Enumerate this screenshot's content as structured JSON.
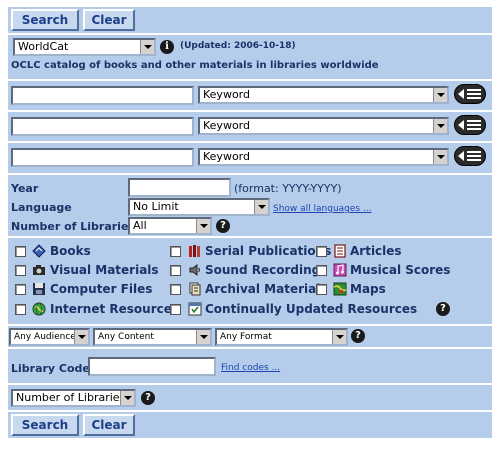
{
  "toolbar_top": {
    "search_label": "Search",
    "clear_label": "Clear"
  },
  "database": {
    "selected": "WorldCat",
    "updated": "(Updated: 2006-10-18)",
    "description": "OCLC catalog of books and other materials in libraries worldwide"
  },
  "search_rows": [
    {
      "value": "",
      "index": "Keyword"
    },
    {
      "value": "",
      "index": "Keyword"
    },
    {
      "value": "",
      "index": "Keyword"
    }
  ],
  "limits": {
    "year_label": "Year",
    "year_value": "",
    "year_format": "(format: YYYY-YYYY)",
    "language_label": "Language",
    "language_value": "No Limit",
    "show_languages": "Show all languages ...",
    "libraries_label": "Number of Libraries",
    "libraries_value": "All"
  },
  "formats": [
    {
      "label": "Books",
      "icon": "book-icon",
      "checked": false
    },
    {
      "label": "Serial Publications",
      "icon": "serial-icon",
      "checked": false
    },
    {
      "label": "Articles",
      "icon": "article-icon",
      "checked": false
    },
    {
      "label": "Visual Materials",
      "icon": "camera-icon",
      "checked": false
    },
    {
      "label": "Sound Recordings",
      "icon": "speaker-icon",
      "checked": false
    },
    {
      "label": "Musical Scores",
      "icon": "music-score-icon",
      "checked": false
    },
    {
      "label": "Computer Files",
      "icon": "disk-icon",
      "checked": false
    },
    {
      "label": "Archival Materials",
      "icon": "archive-icon",
      "checked": false
    },
    {
      "label": "Maps",
      "icon": "map-icon",
      "checked": false
    },
    {
      "label": "Internet Resources",
      "icon": "globe-icon",
      "checked": false
    },
    {
      "label": "Continually Updated Resources",
      "icon": "updated-resources-icon",
      "checked": false
    }
  ],
  "filters": {
    "audience": "Any Audience",
    "content": "Any Content",
    "format": "Any Format"
  },
  "library_code": {
    "label": "Library Code",
    "value": "",
    "find_codes": "Find codes ..."
  },
  "sort": {
    "value": "Number of Libraries"
  },
  "toolbar_bottom": {
    "search_label": "Search",
    "clear_label": "Clear"
  },
  "colors": {
    "band": "#b5cdea",
    "label": "#1a3368",
    "button_text": "#1c3f8a",
    "link": "#1f45b3"
  }
}
